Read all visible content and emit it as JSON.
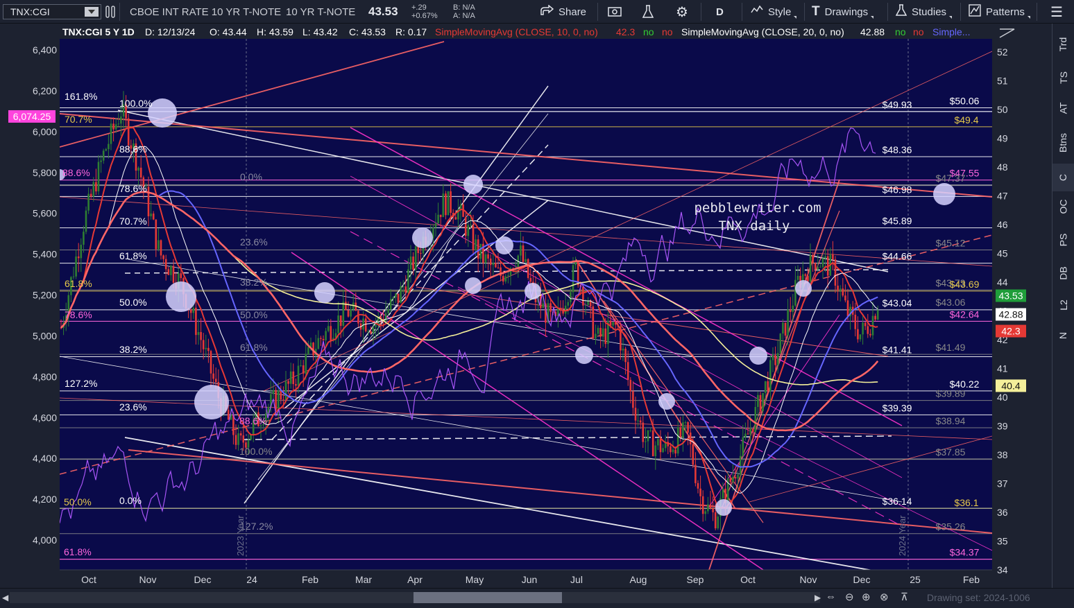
{
  "toolbar": {
    "symbol": "TNX:CGI",
    "description_1": "CBOE INT RATE 10 YR T-NOTE",
    "description_2": "10 YR T-NOTE",
    "last_price": "43.53",
    "change": "+.29",
    "change_pct": "+0.67%",
    "bid": "B: N/A",
    "ask": "A: N/A",
    "share_label": "Share",
    "period_label": "D",
    "style_label": "Style",
    "drawings_label": "Drawings",
    "studies_label": "Studies",
    "patterns_label": "Patterns"
  },
  "header": {
    "title": "TNX:CGI 5 Y 1D",
    "date": "D: 12/13/24",
    "open": "O: 43.44",
    "high": "H: 43.59",
    "low": "L: 43.42",
    "close": "C: 43.53",
    "range": "R: 0.17",
    "sma10": "SimpleMovingAvg (CLOSE, 10, 0, no)",
    "sma10_val": "42.3",
    "sma20": "SimpleMovingAvg (CLOSE, 20, 0, no)",
    "sma20_val": "42.88",
    "flag_no": "no",
    "sma_more": "Simple..."
  },
  "watermark": [
    "pebblewriter.com",
    "TNX daily"
  ],
  "left_axis": [
    "6,400",
    "6,200",
    "6,000",
    "5,800",
    "5,600",
    "5,400",
    "5,200",
    "5,000",
    "4,800",
    "4,600",
    "4,400",
    "4,200",
    "4,000"
  ],
  "left_marker": "6,074.25",
  "right_axis": [
    "52",
    "51",
    "50",
    "49",
    "48",
    "47",
    "46",
    "45",
    "44",
    "43",
    "42",
    "41",
    "40",
    "39",
    "38",
    "37",
    "36",
    "35",
    "34"
  ],
  "right_markers": {
    "last": "43.53",
    "sma20": "42.88",
    "sma10": "42.3",
    "yellow": "40.4"
  },
  "x_axis": [
    "Oct",
    "Nov",
    "Dec",
    "24",
    "Feb",
    "Mar",
    "Apr",
    "May",
    "Jun",
    "Jul",
    "Aug",
    "Sep",
    "Oct",
    "Nov",
    "Dec",
    "25",
    "Feb"
  ],
  "year_labels": [
    "2023 Year",
    "2024 Year"
  ],
  "fib_left": [
    "161.8%",
    "100.0%",
    "70.7%",
    "88.6%",
    "88.6%",
    "78.6%",
    "70.7%",
    "61.8%",
    "61.8%",
    "50.0%",
    "78.6%",
    "38.2%",
    "127.2%",
    "23.6%",
    "88.6%",
    "100.0%",
    "50.0%",
    "0.0%",
    "61.8%"
  ],
  "fib_mid": [
    "0.0%",
    "23.6%",
    "38.2%",
    "50.0%",
    "61.8%",
    "127.2%"
  ],
  "price_levels": [
    "$49.93",
    "$50.06",
    "$49.4",
    "$48.36",
    "$47.55",
    "$47.37",
    "$46.98",
    "$45.89",
    "$45.12",
    "$44.66",
    "$43.73",
    "$43.69",
    "$43.04",
    "$43.06",
    "$42.64",
    "$41.41",
    "$41.49",
    "$40.22",
    "$39.89",
    "$39.39",
    "$38.94",
    "$37.85",
    "$36.14",
    "$36.1",
    "$35.26",
    "$34.37"
  ],
  "sidebar": [
    "Trd",
    "TS",
    "AT",
    "Btns",
    "C",
    "OC",
    "PS",
    "DB",
    "L2",
    "N"
  ],
  "drawing_set": "Drawing set: 2024-1006",
  "colors": {
    "plot_bg": "#0a0a4a",
    "up": "#2e7d32",
    "down": "#e53935",
    "sma10": "#e53935",
    "sma20": "#ffffff",
    "sma50": "#6666ff",
    "sma200": "#f4ef9a",
    "accent_pink": "#ff33cc"
  }
}
